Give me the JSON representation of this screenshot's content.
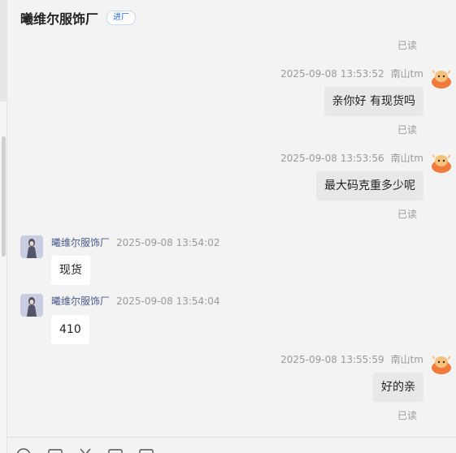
{
  "header": {
    "title": "曦维尔服饰厂",
    "tag": "进厂"
  },
  "read_label": "已读",
  "messages": [
    {
      "direction": "out",
      "time": "2025-09-08 13:53:52",
      "sender": "南山tm",
      "text": "亲你好 有现货吗",
      "status": "已读"
    },
    {
      "direction": "out",
      "time": "2025-09-08 13:53:56",
      "sender": "南山tm",
      "text": "最大码克重多少呢",
      "status": "已读"
    },
    {
      "direction": "in",
      "time": "2025-09-08 13:54:02",
      "sender": "曦维尔服饰厂",
      "text": "现货"
    },
    {
      "direction": "in",
      "time": "2025-09-08 13:54:04",
      "sender": "曦维尔服饰厂",
      "text": "410"
    },
    {
      "direction": "out",
      "time": "2025-09-08 13:55:59",
      "sender": "南山tm",
      "text": "好的亲",
      "status": "已读"
    }
  ],
  "toolbar": {
    "icons": [
      "emoji-icon",
      "image-icon",
      "scissors-icon",
      "folder-icon",
      "chat-history-icon"
    ]
  },
  "colors": {
    "background": "#f3f3f3",
    "outgoing_bubble": "#e8e8e8",
    "incoming_bubble": "#ffffff",
    "tag_text": "#2f6dd0",
    "sender_name": "#4a5a8c"
  }
}
